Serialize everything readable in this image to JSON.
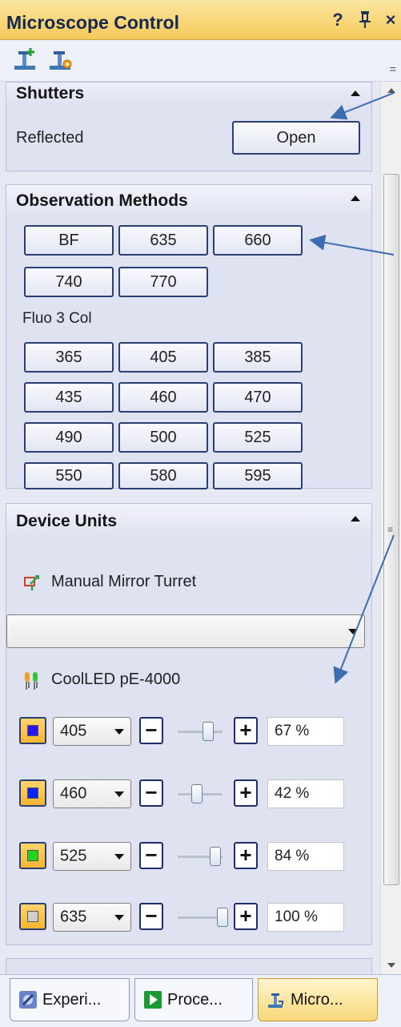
{
  "window": {
    "title": "Microscope Control",
    "help_icon": "?",
    "pin_icon": "pin-icon",
    "close_icon": "×"
  },
  "toolbar": {
    "more_label": "="
  },
  "shutters": {
    "title": "Shutters",
    "row_label": "Reflected",
    "button_label": "Open"
  },
  "observation": {
    "title": "Observation Methods",
    "row1": [
      "BF",
      "635",
      "660"
    ],
    "row2": [
      "740",
      "770"
    ],
    "fluo_label": "Fluo 3 Col",
    "fluo_rows": [
      [
        "365",
        "405",
        "385"
      ],
      [
        "435",
        "460",
        "470"
      ],
      [
        "490",
        "500",
        "525"
      ],
      [
        "550",
        "580",
        "595"
      ]
    ]
  },
  "device_units": {
    "title": "Device Units",
    "turret_label": "Manual Mirror Turret",
    "turret_value": "",
    "led_label": "CoolLED pE-4000",
    "channels": [
      {
        "wavelength": "405",
        "color": "#2a14ff",
        "level": 67,
        "percent": "67 %"
      },
      {
        "wavelength": "460",
        "color": "#0a24ff",
        "level": 42,
        "percent": "42 %"
      },
      {
        "wavelength": "525",
        "color": "#21d61b",
        "level": 84,
        "percent": "84 %"
      },
      {
        "wavelength": "635",
        "color": "#cfcfcf",
        "level": 100,
        "percent": "100 %"
      }
    ],
    "minus": "−",
    "plus": "+"
  },
  "tabs": [
    {
      "label": "Experi...",
      "icon": "experiment-icon"
    },
    {
      "label": "Proce...",
      "icon": "process-icon"
    },
    {
      "label": "Micro...",
      "icon": "microscope-icon"
    }
  ],
  "colors": {
    "title_bar": "#f5c95a",
    "panel_bg": "#e6e8f4",
    "button_border": "#2c3f72",
    "annotation_arrow": "#3c6db0"
  }
}
